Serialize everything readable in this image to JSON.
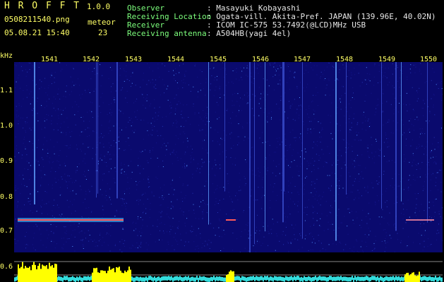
{
  "header": {
    "app_title": "H R O F F T",
    "version": "1.0.0",
    "filename": "0508211540.png",
    "datetime": "05.08.21 15:40",
    "meteor_label": "meteor",
    "meteor_count": "23",
    "info_labels": [
      "Observer",
      "Receiving Location",
      "Receiver",
      "Receiving antenna"
    ],
    "info_values": [
      ": Masayuki Kobayashi",
      ": Ogata-vill. Akita-Pref. JAPAN (139.96E, 40.02N)",
      ": ICOM IC-575 53.7492(@LCD)MHz USB",
      ": A504HB(yagi 4el)"
    ]
  },
  "axis": {
    "unit": "kHz",
    "y_ticks": [
      "1.1",
      "1.0",
      "0.9",
      "0.8",
      "0.7",
      "0.6"
    ],
    "x_ticks": [
      "1541",
      "1542",
      "1543",
      "1544",
      "1545",
      "1546",
      "1547",
      "1548",
      "1549",
      "1550"
    ]
  },
  "colors": {
    "background": "#000000",
    "spectrogram_bg": "#0a0a6e",
    "label_yellow": "#ffff66",
    "info_green": "#7dff7d",
    "signal_band": "#ff5a5a",
    "level_bars": "#ffff00",
    "noise_floor": "#33dddd"
  }
}
